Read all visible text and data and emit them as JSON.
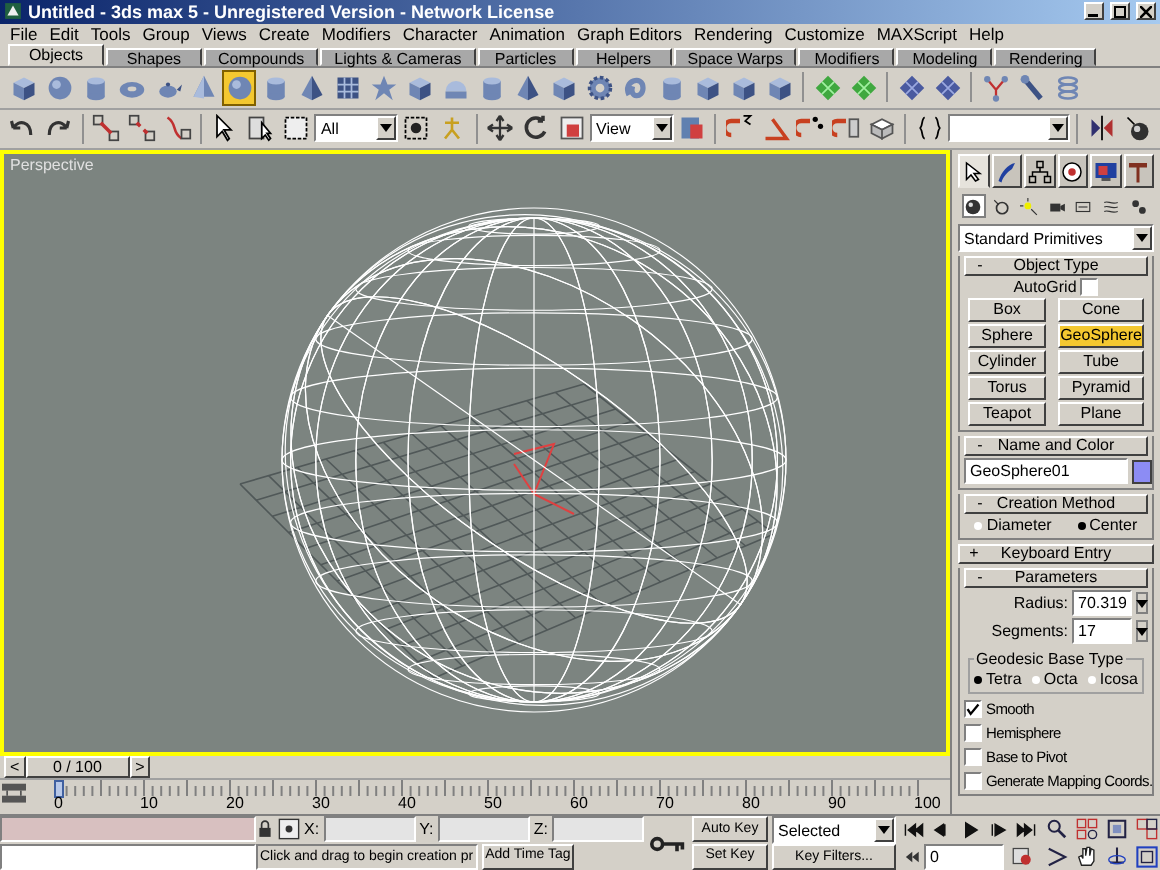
{
  "window": {
    "title": "Untitled - 3ds max 5 - Unregistered Version - Network License"
  },
  "menu": [
    "File",
    "Edit",
    "Tools",
    "Group",
    "Views",
    "Create",
    "Modifiers",
    "Character",
    "Animation",
    "Graph Editors",
    "Rendering",
    "Customize",
    "MAXScript",
    "Help"
  ],
  "tabs": [
    {
      "label": "Objects",
      "selected": true
    },
    {
      "label": "Shapes",
      "selected": false
    },
    {
      "label": "Compounds",
      "selected": false
    },
    {
      "label": "Lights & Cameras",
      "selected": false
    },
    {
      "label": "Particles",
      "selected": false
    },
    {
      "label": "Helpers",
      "selected": false
    },
    {
      "label": "Space Warps",
      "selected": false
    },
    {
      "label": "Modifiers",
      "selected": false
    },
    {
      "label": "Modeling",
      "selected": false
    },
    {
      "label": "Rendering",
      "selected": false
    }
  ],
  "create_tools": [
    {
      "kind": "box",
      "selected": false
    },
    {
      "kind": "sphere",
      "selected": false
    },
    {
      "kind": "cylinder",
      "selected": false
    },
    {
      "kind": "torus",
      "selected": false
    },
    {
      "kind": "teapot",
      "selected": false
    },
    {
      "kind": "cone",
      "selected": false
    },
    {
      "kind": "sphere",
      "selected": true
    },
    {
      "kind": "cylinder",
      "selected": false
    },
    {
      "kind": "pyramid",
      "selected": false
    },
    {
      "kind": "grid",
      "selected": false
    },
    {
      "kind": "star",
      "selected": false
    },
    {
      "kind": "box",
      "selected": false
    },
    {
      "kind": "dome",
      "selected": false
    },
    {
      "kind": "cylinder",
      "selected": false
    },
    {
      "kind": "pyramid",
      "selected": false
    },
    {
      "kind": "box",
      "selected": false
    },
    {
      "kind": "gear",
      "selected": false
    },
    {
      "kind": "knot",
      "selected": false
    },
    {
      "kind": "cylinder",
      "selected": false
    },
    {
      "kind": "box",
      "selected": false
    },
    {
      "kind": "box",
      "selected": false
    },
    {
      "kind": "box",
      "selected": false
    },
    {
      "kind": "patch",
      "selected": false
    },
    {
      "kind": "patch",
      "selected": false
    },
    {
      "kind": "nurbs",
      "selected": false
    },
    {
      "kind": "nurbs",
      "selected": false
    },
    {
      "kind": "branch",
      "selected": false
    },
    {
      "kind": "tool",
      "selected": false
    },
    {
      "kind": "spring",
      "selected": false
    }
  ],
  "main_toolbar": {
    "selection_filter": "All",
    "reference_coord": "View"
  },
  "viewport": {
    "label": "Perspective",
    "active": true
  },
  "command_panel": {
    "tabs": [
      {
        "kind": "create",
        "selected": true
      },
      {
        "kind": "modify",
        "selected": false
      },
      {
        "kind": "hierarchy",
        "selected": false
      },
      {
        "kind": "motion",
        "selected": false
      },
      {
        "kind": "display",
        "selected": false
      },
      {
        "kind": "utilities",
        "selected": false
      }
    ],
    "categories": [
      {
        "kind": "geometry",
        "selected": true
      },
      {
        "kind": "shapes",
        "selected": false
      },
      {
        "kind": "lights",
        "selected": false
      },
      {
        "kind": "cameras",
        "selected": false
      },
      {
        "kind": "helpers",
        "selected": false
      },
      {
        "kind": "spacewarps",
        "selected": false
      },
      {
        "kind": "systems",
        "selected": false
      }
    ],
    "category_dropdown": "Standard Primitives",
    "object_type": {
      "toggle": "-",
      "title": "Object Type",
      "autogrid_label": "AutoGrid",
      "autogrid": false,
      "buttons": [
        {
          "label": "Box",
          "selected": false
        },
        {
          "label": "Cone",
          "selected": false
        },
        {
          "label": "Sphere",
          "selected": false
        },
        {
          "label": "GeoSphere",
          "selected": true
        },
        {
          "label": "Cylinder",
          "selected": false
        },
        {
          "label": "Tube",
          "selected": false
        },
        {
          "label": "Torus",
          "selected": false
        },
        {
          "label": "Pyramid",
          "selected": false
        },
        {
          "label": "Teapot",
          "selected": false
        },
        {
          "label": "Plane",
          "selected": false
        }
      ]
    },
    "name_and_color": {
      "toggle": "-",
      "title": "Name and Color",
      "name": "GeoSphere01",
      "color": "#8c8cf4"
    },
    "creation_method": {
      "toggle": "-",
      "title": "Creation Method",
      "options": [
        {
          "label": "Diameter",
          "selected": false
        },
        {
          "label": "Center",
          "selected": true
        }
      ]
    },
    "keyboard_entry": {
      "toggle": "+",
      "title": "Keyboard Entry"
    },
    "parameters": {
      "toggle": "-",
      "title": "Parameters",
      "radius_label": "Radius:",
      "radius": "70.319",
      "segments_label": "Segments:",
      "segments": "17",
      "base_type_title": "Geodesic Base Type",
      "base_types": [
        {
          "label": "Tetra",
          "selected": true
        },
        {
          "label": "Octa",
          "selected": false
        },
        {
          "label": "Icosa",
          "selected": false
        }
      ],
      "options": [
        {
          "label": "Smooth",
          "checked": true
        },
        {
          "label": "Hemisphere",
          "checked": false
        },
        {
          "label": "Base to Pivot",
          "checked": false
        },
        {
          "label": "Generate Mapping Coords.",
          "checked": false
        }
      ]
    }
  },
  "time_slider": {
    "prev": "<",
    "label": "0 / 100",
    "next": ">"
  },
  "ruler": [
    "0",
    "10",
    "20",
    "30",
    "40",
    "50",
    "60",
    "70",
    "80",
    "90",
    "100"
  ],
  "status": {
    "x_label": "X:",
    "y_label": "Y:",
    "z_label": "Z:",
    "prompt": "Click and drag to begin creation pr",
    "time_tag": "Add Time Tag",
    "auto_key": "Auto Key",
    "set_key": "Set Key",
    "key_mode": "Selected",
    "key_filters": "Key Filters...",
    "frame": "0"
  }
}
